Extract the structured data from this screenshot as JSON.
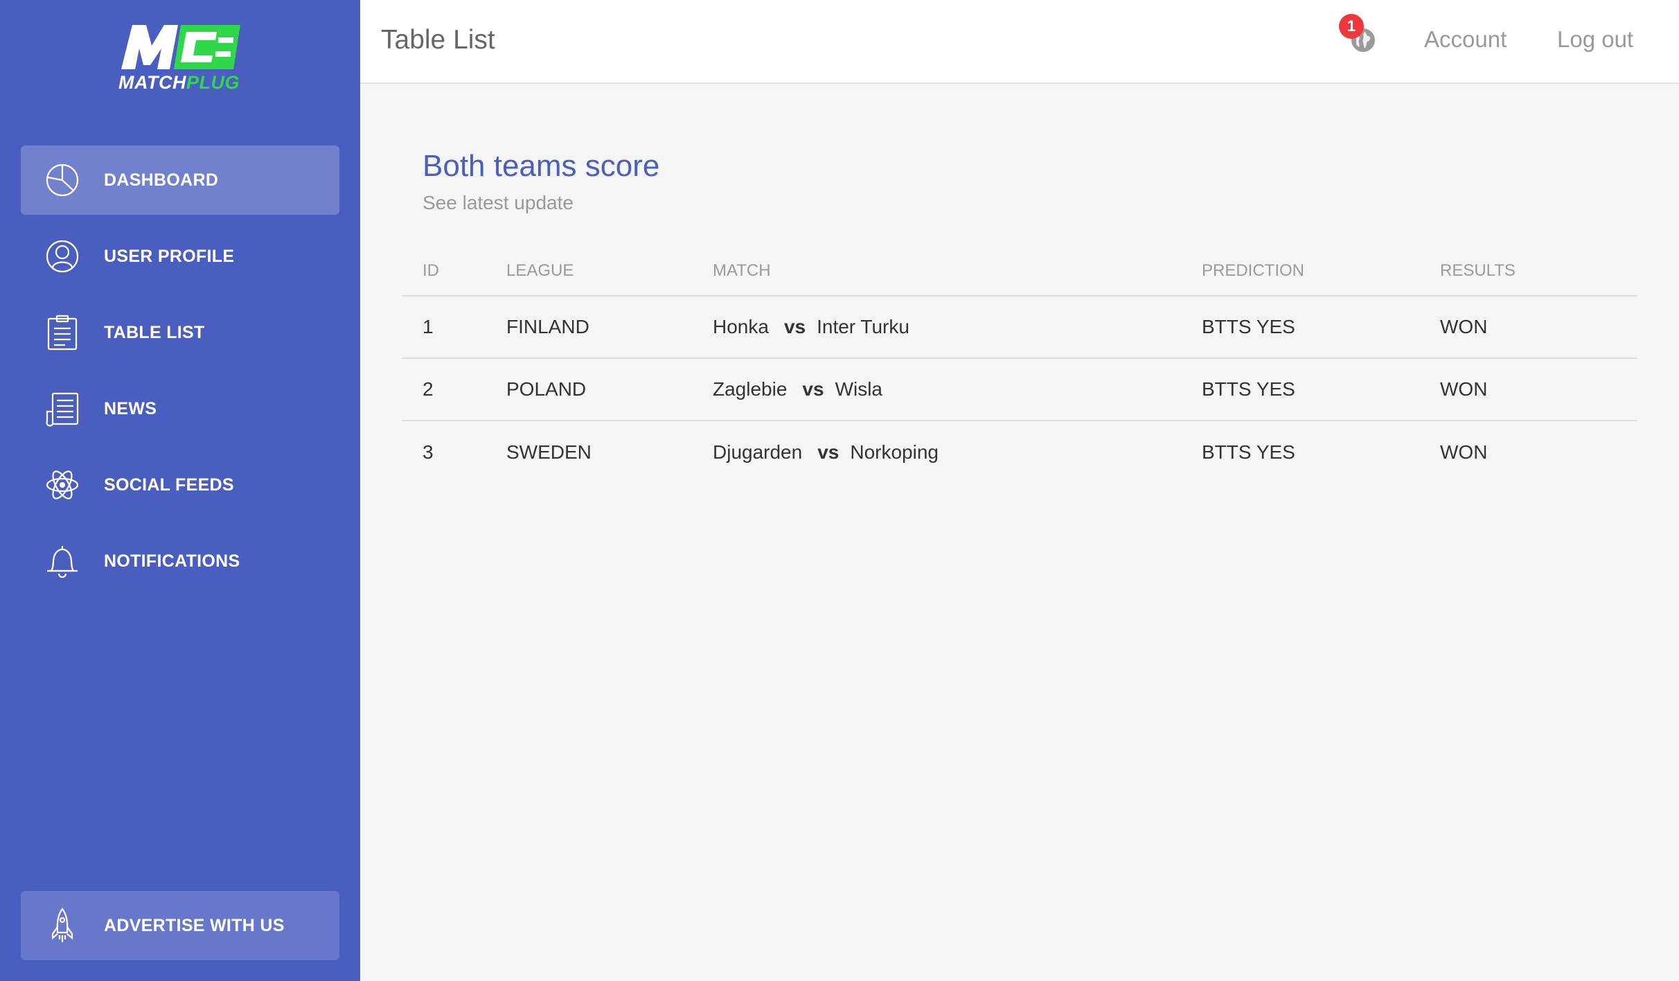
{
  "brand": {
    "logo_text_white": "MATCH",
    "logo_text_green": "PLUG",
    "accent_color": "#4a5ec0",
    "logo_green": "#2fd84a"
  },
  "sidebar": {
    "items": [
      {
        "label": "DASHBOARD",
        "icon": "pie-chart-icon",
        "active": true
      },
      {
        "label": "USER PROFILE",
        "icon": "user-icon",
        "active": false
      },
      {
        "label": "TABLE LIST",
        "icon": "clipboard-icon",
        "active": false
      },
      {
        "label": "NEWS",
        "icon": "newspaper-icon",
        "active": false
      },
      {
        "label": "SOCIAL FEEDS",
        "icon": "atom-icon",
        "active": false
      },
      {
        "label": "NOTIFICATIONS",
        "icon": "bell-icon",
        "active": false
      }
    ],
    "advertise": {
      "label": "ADVERTISE WITH US",
      "icon": "rocket-icon"
    }
  },
  "header": {
    "title": "Table List",
    "notification_count": "1",
    "account_label": "Account",
    "logout_label": "Log out"
  },
  "card": {
    "title": "Both teams score",
    "subtitle": "See latest update",
    "columns": [
      "ID",
      "LEAGUE",
      "MATCH",
      "PREDICTION",
      "RESULTS"
    ],
    "vs_label": "vs",
    "rows": [
      {
        "id": "1",
        "league": "FINLAND",
        "home": "Honka",
        "away": "Inter Turku",
        "prediction": "BTTS YES",
        "result": "WON"
      },
      {
        "id": "2",
        "league": "POLAND",
        "home": "Zaglebie",
        "away": "Wisla",
        "prediction": "BTTS YES",
        "result": "WON"
      },
      {
        "id": "3",
        "league": "SWEDEN",
        "home": "Djugarden",
        "away": "Norkoping",
        "prediction": "BTTS YES",
        "result": "WON"
      }
    ]
  }
}
